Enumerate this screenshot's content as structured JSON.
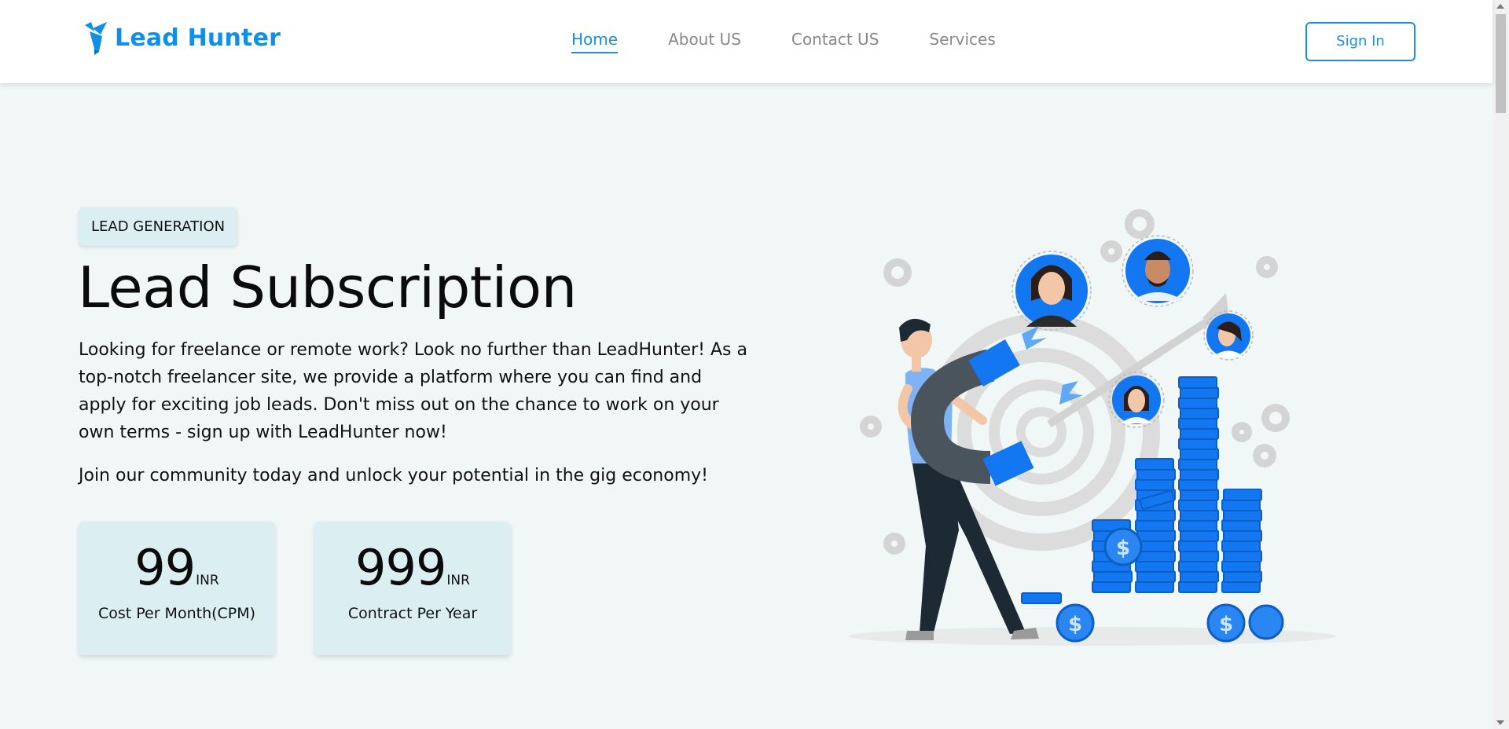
{
  "brand": {
    "name": "Lead Hunter",
    "accent": "#0f8fe8"
  },
  "nav": {
    "links": [
      {
        "label": "Home",
        "active": true
      },
      {
        "label": "About US",
        "active": false
      },
      {
        "label": "Contact US",
        "active": false
      },
      {
        "label": "Services",
        "active": false
      }
    ],
    "signin_label": "Sign In"
  },
  "hero": {
    "badge": "LEAD GENERATION",
    "title": "Lead Subscription",
    "description": "Looking for freelance or remote work? Look no further than LeadHunter! As a top-notch freelancer site, we provide a platform where you can find and apply for exciting job leads. Don't miss out on the chance to work on your own terms - sign up with LeadHunter now!",
    "join": "Join our community today and unlock your potential in the gig economy!"
  },
  "pricing": [
    {
      "amount": "99",
      "unit": "INR",
      "label": "Cost Per Month(CPM)"
    },
    {
      "amount": "999",
      "unit": "INR",
      "label": "Contract Per Year"
    }
  ],
  "illustration": {
    "icons": [
      "magnet-icon",
      "target-icon",
      "coin-icon",
      "gear-icon",
      "avatar-icon"
    ],
    "colors": {
      "primary": "#1277f0",
      "dark": "#1e2a33",
      "gray": "#d9d9d9"
    }
  }
}
